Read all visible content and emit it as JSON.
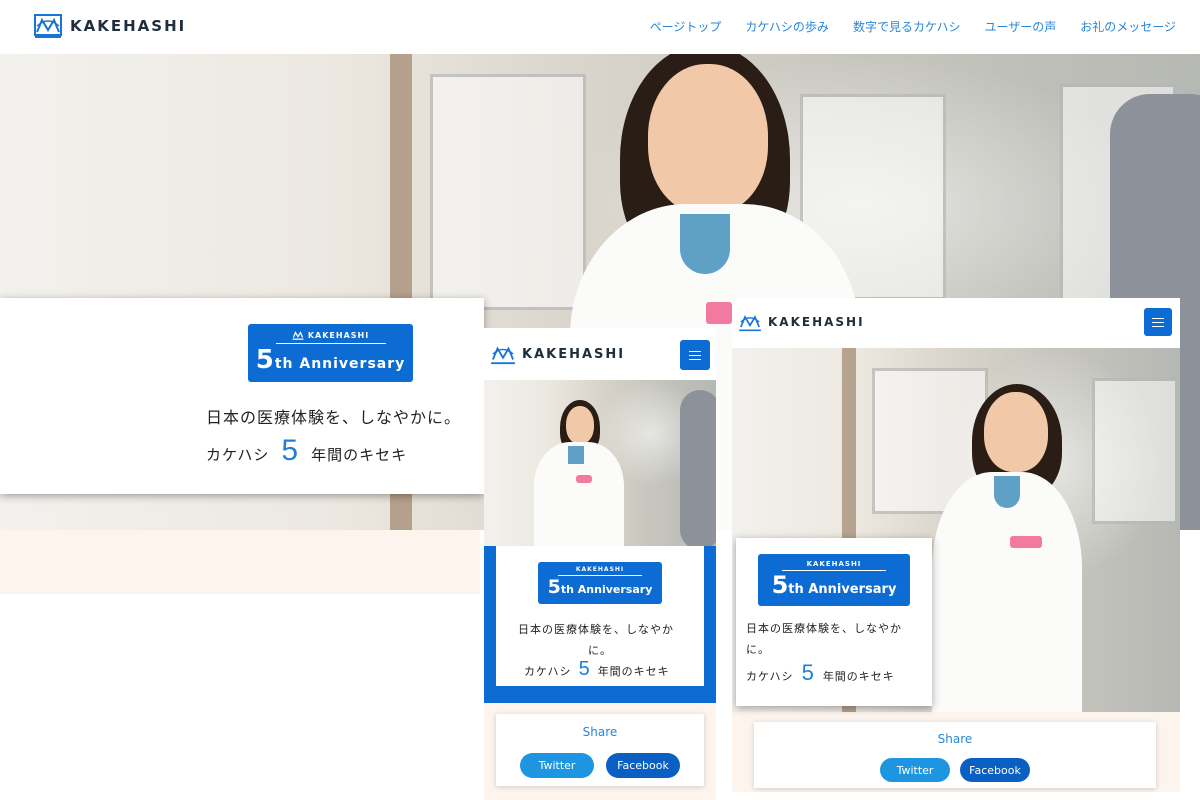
{
  "brand": {
    "name": "KAKEHASHI",
    "color": "#0c6cd4",
    "accent": "#1f7fd8"
  },
  "nav": {
    "items": [
      {
        "label": "ページトップ"
      },
      {
        "label": "カケハシの歩み"
      },
      {
        "label": "数字で見るカケハシ"
      },
      {
        "label": "ユーザーの声"
      },
      {
        "label": "お礼のメッセージ"
      }
    ]
  },
  "hero": {
    "anniversary_brand": "KAKEHASHI",
    "anniversary_number": "5",
    "anniversary_suffix": "th",
    "anniversary_word": "Anniversary",
    "tagline": "日本の医療体験を、しなやかに。",
    "tagline_mobile_1": "日本の医療体験を、しなやか",
    "tagline_mobile_2": "に。",
    "tagline_tablet_1": "日本の医療体験を、しなやか",
    "tagline_tablet_2": "に。",
    "years_prefix": "カケハシ",
    "years_number": "5",
    "years_suffix": "年間のキセキ"
  },
  "share": {
    "title": "Share",
    "twitter_label": "Twitter",
    "facebook_label": "Facebook"
  },
  "icons": {
    "logo": "kakehashi-logo-icon",
    "menu": "hamburger-menu-icon"
  }
}
